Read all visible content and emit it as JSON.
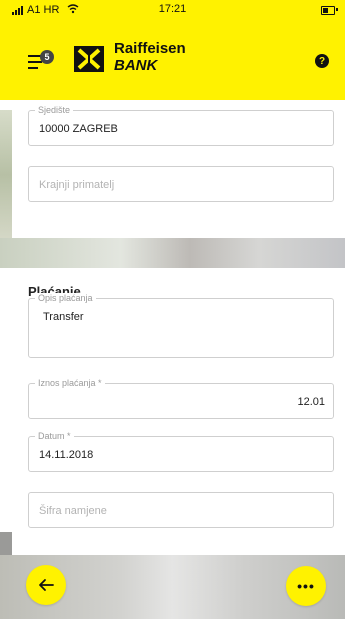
{
  "status_bar": {
    "carrier": "A1 HR",
    "time": "17:21"
  },
  "header": {
    "menu_badge_count": "5",
    "logo_name": "Raiffeisen",
    "logo_bank": "BANK",
    "help_icon": "?"
  },
  "form": {
    "sjediste": {
      "label": "Sjedište",
      "value": "10000 ZAGREB"
    },
    "krajnji_primatelj": {
      "placeholder": "Krajnji primatelj"
    },
    "section_title": "Plaćanje",
    "opis_placanja": {
      "label": "Opis plaćanja",
      "value": "Transfer"
    },
    "iznos_placanja": {
      "label": "Iznos plaćanja *",
      "value": "12.01"
    },
    "datum": {
      "label": "Datum *",
      "value": "14.11.2018"
    },
    "sifra_namjene": {
      "placeholder": "Šifra namjene"
    }
  },
  "actions": {
    "back_icon": "arrow-left-icon",
    "more_icon": "more-icon",
    "more_glyph": "•••"
  },
  "colors": {
    "brand_yellow": "#fff200",
    "text_dark": "#111111"
  }
}
